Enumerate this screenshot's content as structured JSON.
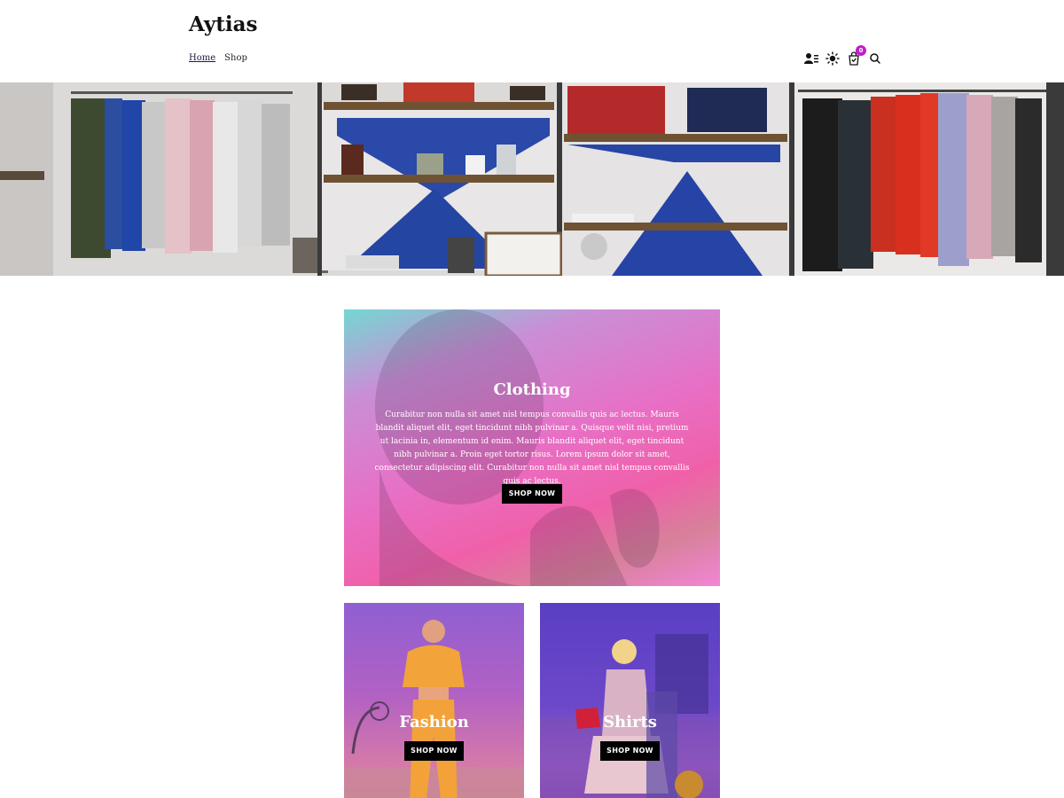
{
  "site": {
    "title": "Aytias"
  },
  "nav": {
    "items": [
      {
        "label": "Home"
      },
      {
        "label": "Shop"
      }
    ]
  },
  "header_icons": {
    "account": "user-list-icon",
    "theme": "sun-icon",
    "cart": "cart-icon",
    "cart_count": "0",
    "search": "search-icon"
  },
  "hero": {
    "image": "clothing-store-interior"
  },
  "cards": {
    "clothing": {
      "title": "Clothing",
      "text": "Curabitur non nulla sit amet nisl tempus convallis quis ac lectus. Mauris blandit aliquet elit, eget tincidunt nibh pulvinar a. Quisque velit nisi, pretium ut lacinia in, elementum id enim. Mauris blandit aliquet elit, eget tincidunt nibh pulvinar a. Proin eget tortor risus. Lorem ipsum dolor sit amet, consectetur adipiscing elit. Curabitur non nulla sit amet nisl tempus convallis quis ac lectus.",
      "button": "SHOP NOW"
    },
    "fashion": {
      "title": "Fashion",
      "button": "SHOP NOW"
    },
    "shirts": {
      "title": "Shirts",
      "button": "SHOP NOW"
    }
  },
  "colors": {
    "accent": "#c21ccd",
    "button_bg": "#000000"
  }
}
